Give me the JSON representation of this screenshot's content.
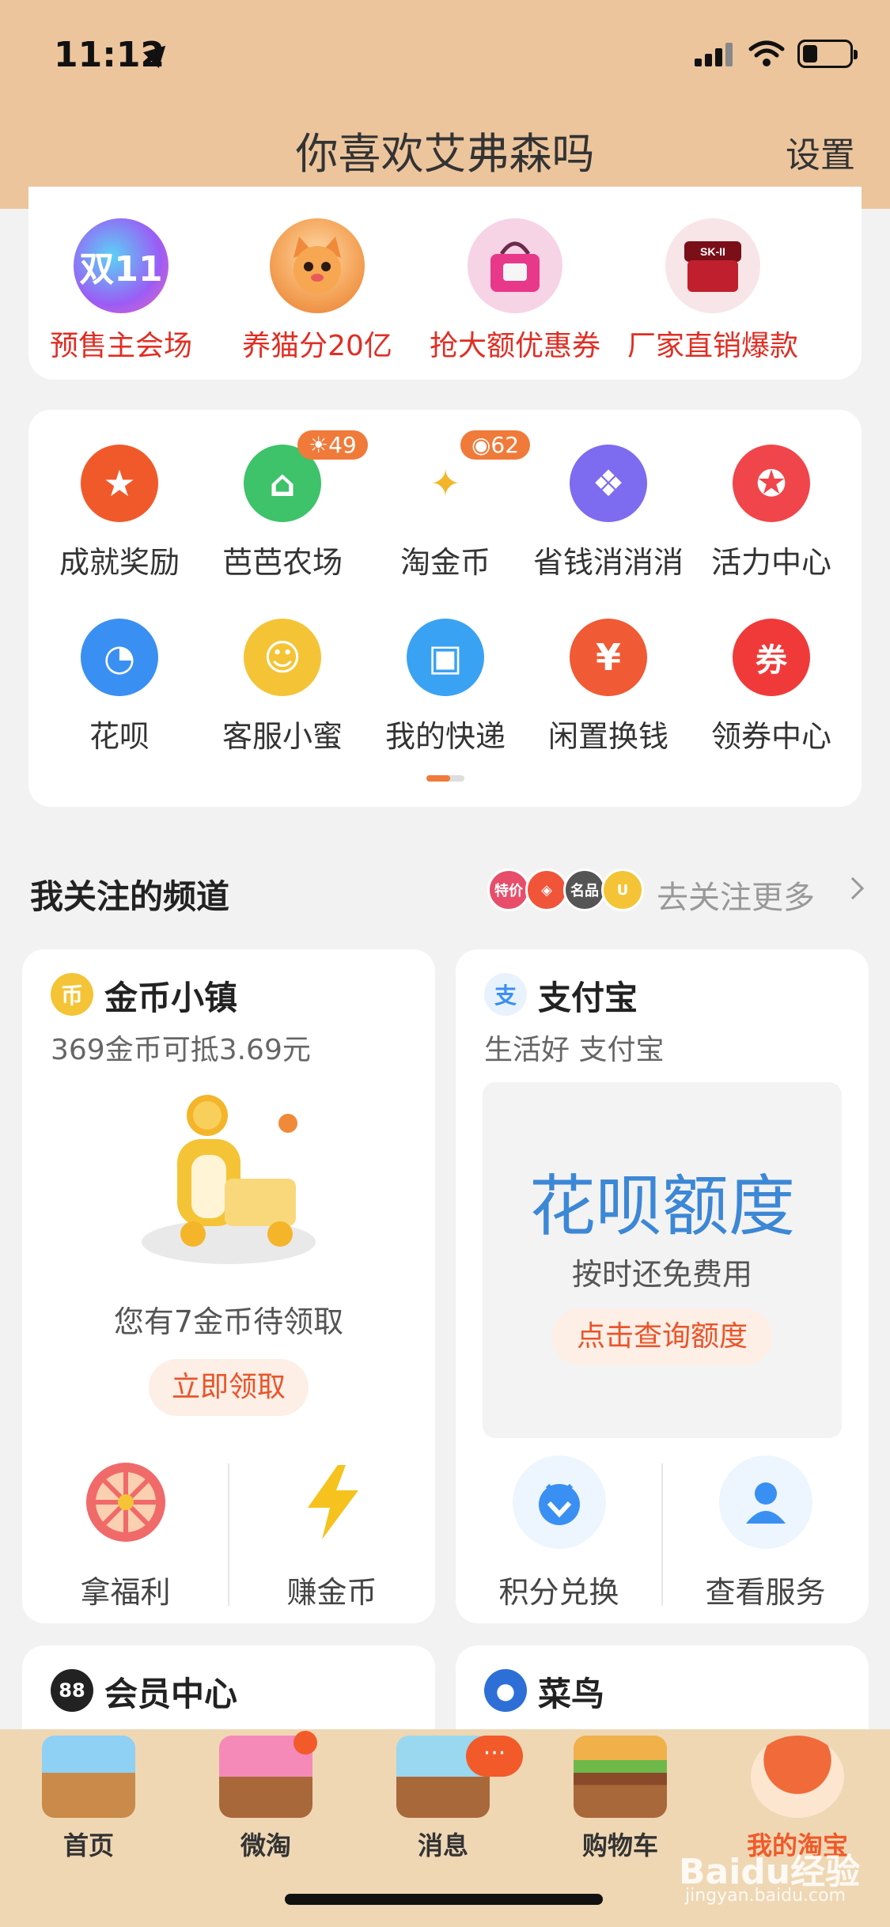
{
  "status": {
    "time": "11:12"
  },
  "header": {
    "title": "你喜欢艾弗森吗",
    "settings": "设置"
  },
  "promo": [
    {
      "label": "预售主会场",
      "icon": "double11",
      "text": "双11",
      "color": "#9b5cf5"
    },
    {
      "label": "养猫分20亿",
      "icon": "cat",
      "text": "",
      "color": "#f4a55a"
    },
    {
      "label": "抢大额优惠券",
      "icon": "handbag",
      "text": "",
      "color": "#e84d8f"
    },
    {
      "label": "厂家直销爆款",
      "icon": "skii-jar",
      "text": "SK-II",
      "color": "#b01e28"
    }
  ],
  "grid": [
    {
      "label": "成就奖励",
      "icon": "trophy",
      "color": "#f05a2a",
      "glyph": "★",
      "badge": ""
    },
    {
      "label": "芭芭农场",
      "icon": "farm-house",
      "color": "#3ec26a",
      "glyph": "⌂",
      "badge": "☀49"
    },
    {
      "label": "淘金币",
      "icon": "gold-coin",
      "color": "#f5d35a",
      "glyph": "✦",
      "badge": "◉62"
    },
    {
      "label": "省钱消消消",
      "icon": "puzzle",
      "color": "#7d6bf0",
      "glyph": "❖",
      "badge": ""
    },
    {
      "label": "活力中心",
      "icon": "medal",
      "color": "#f0454a",
      "glyph": "✪",
      "badge": ""
    },
    {
      "label": "花呗",
      "icon": "huabei",
      "color": "#3a8ff2",
      "glyph": "◔",
      "badge": ""
    },
    {
      "label": "客服小蜜",
      "icon": "service-bot",
      "color": "#f4c436",
      "glyph": "☺",
      "badge": ""
    },
    {
      "label": "我的快递",
      "icon": "package",
      "color": "#3aa2f2",
      "glyph": "▣",
      "badge": ""
    },
    {
      "label": "闲置换钱",
      "icon": "money-bag",
      "color": "#f05a34",
      "glyph": "¥",
      "badge": ""
    },
    {
      "label": "领券中心",
      "icon": "coupon",
      "color": "#f03a3a",
      "glyph": "券",
      "badge": ""
    }
  ],
  "channels": {
    "title": "我关注的频道",
    "more": "去关注更多",
    "minis": [
      {
        "text": "特价",
        "color": "#e84d6a"
      },
      {
        "text": "◈",
        "color": "#f0553a"
      },
      {
        "text": "名品",
        "color": "#555555"
      },
      {
        "text": "U",
        "color": "#f4c436"
      }
    ],
    "gold": {
      "title": "金币小镇",
      "icon_text": "币",
      "sub": "369金币可抵3.69元",
      "claim_text": "您有7金币待领取",
      "claim_btn": "立即领取",
      "items": [
        {
          "label": "拿福利"
        },
        {
          "label": "赚金币"
        }
      ]
    },
    "alipay": {
      "title": "支付宝",
      "icon_text": "支",
      "sub": "生活好 支付宝",
      "box_title": "花呗额度",
      "box_sub": "按时还免费用",
      "box_btn": "点击查询额度",
      "items": [
        {
          "label": "积分兑换"
        },
        {
          "label": "查看服务"
        }
      ]
    },
    "member": {
      "title": "会员中心",
      "icon_text": "88"
    },
    "cainiao": {
      "title": "菜鸟",
      "icon_text": "●"
    }
  },
  "tabs": [
    {
      "label": "首页",
      "icon": "home-page-sign"
    },
    {
      "label": "微淘",
      "icon": "doughnut-shop"
    },
    {
      "label": "消息",
      "icon": "message-box",
      "badge": "···"
    },
    {
      "label": "购物车",
      "icon": "burger-cart"
    },
    {
      "label": "我的淘宝",
      "icon": "mushroom-avatar"
    }
  ],
  "watermark": {
    "brand": "Baidu经验",
    "site": "jingyan.baidu.com"
  }
}
